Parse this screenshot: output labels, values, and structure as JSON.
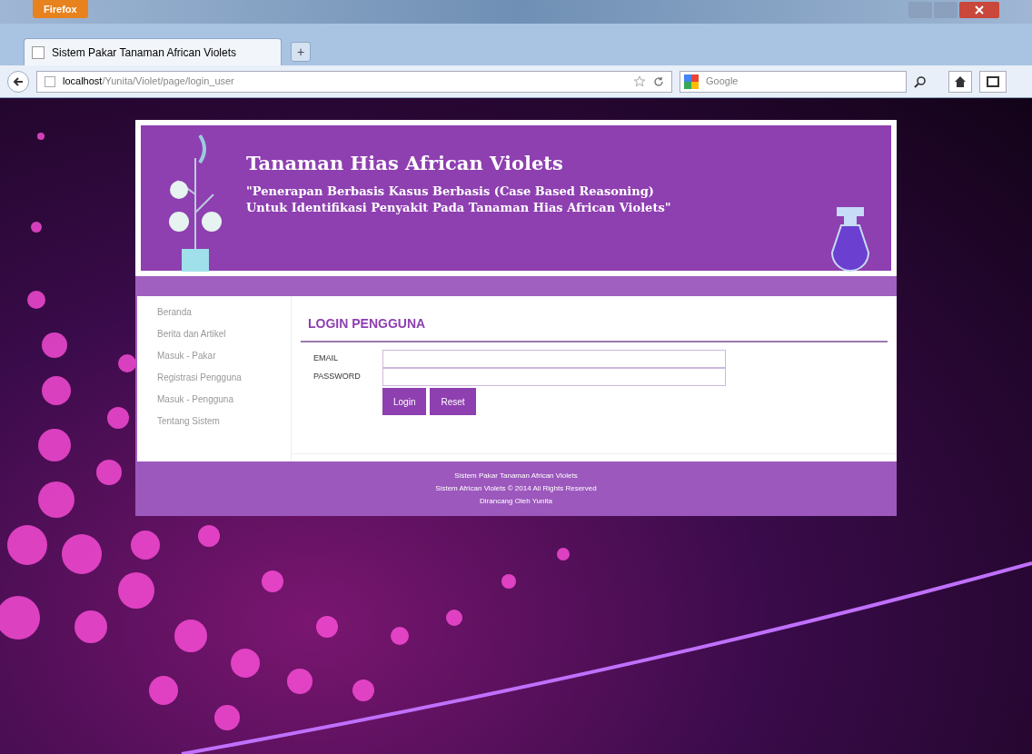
{
  "browser": {
    "menu_button": "Firefox",
    "tab_title": "Sistem Pakar Tanaman African Violets",
    "new_tab": "+",
    "url_host": "localhost",
    "url_path": "/Yunita/Violet/page/login_user",
    "search_placeholder": "Google"
  },
  "header": {
    "title": "Tanaman Hias African Violets",
    "subtitle_line_1": "\"Penerapan Berbasis Kasus Berbasis (Case Based Reasoning)",
    "subtitle_line_2": "Untuk Identifikasi Penyakit Pada Tanaman Hias African Violets\""
  },
  "sidebar": {
    "items": [
      {
        "label": "Beranda"
      },
      {
        "label": "Berita dan Artikel"
      },
      {
        "label": "Masuk - Pakar"
      },
      {
        "label": "Registrasi Pengguna"
      },
      {
        "label": "Masuk - Pengguna"
      },
      {
        "label": "Tentang Sistem"
      }
    ]
  },
  "login": {
    "heading": "LOGIN PENGGUNA",
    "fields": [
      {
        "label": "EMAIL"
      },
      {
        "label": "PASSWORD"
      }
    ],
    "buttons": [
      "Login",
      "Reset"
    ]
  },
  "footer": {
    "lines": [
      "Sistem Pakar Tanaman African Violets",
      "Sistem African Violets © 2014 All Rights Reserved",
      "Dirancang Oleh Yunita"
    ]
  }
}
